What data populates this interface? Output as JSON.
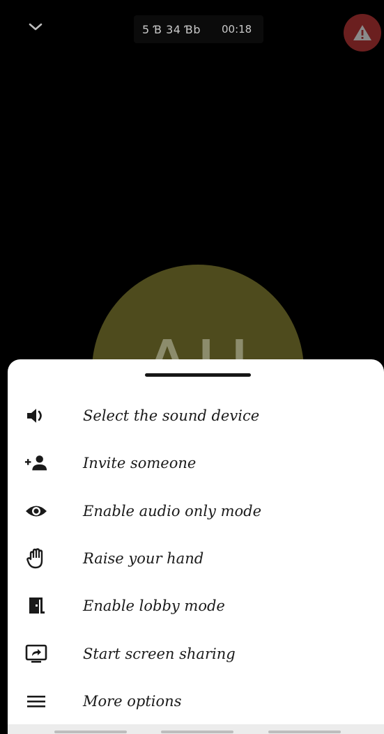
{
  "call": {
    "room_name": "5 Ɓ 34 Ɓb",
    "timer": "00:18",
    "avatar_initials": "AU"
  },
  "menu": {
    "items": [
      {
        "label": "Select the sound device",
        "icon": "speaker-icon"
      },
      {
        "label": "Invite someone",
        "icon": "add-person-icon"
      },
      {
        "label": "Enable audio only mode",
        "icon": "eye-icon"
      },
      {
        "label": "Raise your hand",
        "icon": "hand-icon"
      },
      {
        "label": "Enable lobby mode",
        "icon": "door-icon"
      },
      {
        "label": "Start screen sharing",
        "icon": "screen-share-icon"
      },
      {
        "label": "More options",
        "icon": "menu-lines-icon"
      }
    ]
  },
  "colors": {
    "background": "#000000",
    "avatar": "#4e4b1d",
    "warning": "#6b1f1f",
    "sheet": "#ffffff"
  }
}
